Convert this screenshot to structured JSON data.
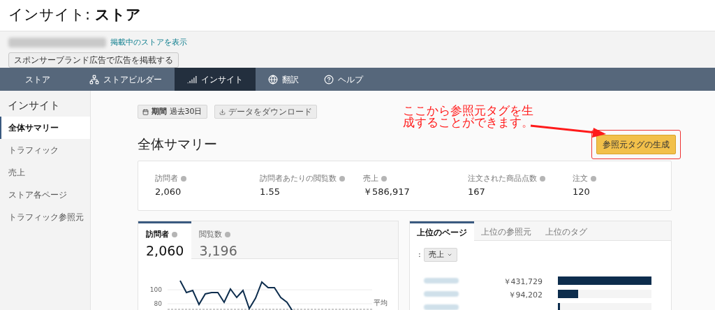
{
  "header": {
    "title": "インサイト: **ストア**"
  },
  "store_bar": {
    "link": "掲載中のストアを表示",
    "button": "スポンサーブランド広告で広告を掲載する"
  },
  "nav": [
    {
      "label": "ストア",
      "kind": "plain",
      "selected": false
    },
    {
      "label": "ストアビルダー",
      "kind": "sitemap",
      "selected": false
    },
    {
      "label": "インサイト",
      "kind": "signal",
      "selected": true
    },
    {
      "label": "翻訳",
      "kind": "globe",
      "selected": false
    },
    {
      "label": "ヘルプ",
      "kind": "help",
      "selected": false
    }
  ],
  "sidebar": {
    "title": "インサイト",
    "items": [
      {
        "label": "全体サマリー",
        "selected": true
      },
      {
        "label": "トラフィック",
        "selected": false
      },
      {
        "label": "売上",
        "selected": false
      },
      {
        "label": "ストア各ページ",
        "selected": false
      },
      {
        "label": "トラフィック参照元",
        "selected": false
      }
    ]
  },
  "toolbar": {
    "period_label": "期間",
    "period_value": "過去30日",
    "download": "データをダウンロード"
  },
  "summary": {
    "title": "全体サマリー",
    "generate_button": "参照元タグの生成",
    "annotation": "ここから参照元タグを生成することができます。",
    "metrics": [
      {
        "label": "訪問者",
        "value": "2,060"
      },
      {
        "label": "訪問者あたりの閲覧数",
        "value": "1.55"
      },
      {
        "label": "売上",
        "value": "￥586,917"
      },
      {
        "label": "注文された商品点数",
        "value": "167"
      },
      {
        "label": "注文",
        "value": "120"
      }
    ]
  },
  "trend": {
    "tabs": [
      {
        "label": "訪問者",
        "value": "2,060",
        "selected": true
      },
      {
        "label": "閲覧数",
        "value": "3,196",
        "selected": false
      }
    ],
    "chart": {
      "tick_labels": [
        "100",
        "80"
      ],
      "average_label": "平均"
    }
  },
  "top": {
    "tabs": [
      {
        "label": "上位のページ",
        "selected": true
      },
      {
        "label": "上位の参照元",
        "selected": false
      },
      {
        "label": "上位のタグ",
        "selected": false
      }
    ],
    "sort": {
      "prefix": ":",
      "value": "売上"
    },
    "rows": [
      {
        "value": "￥431,729",
        "level": 1
      },
      {
        "value": "￥94,202",
        "level": 0.22
      },
      {
        "level": 0.02
      }
    ]
  }
}
